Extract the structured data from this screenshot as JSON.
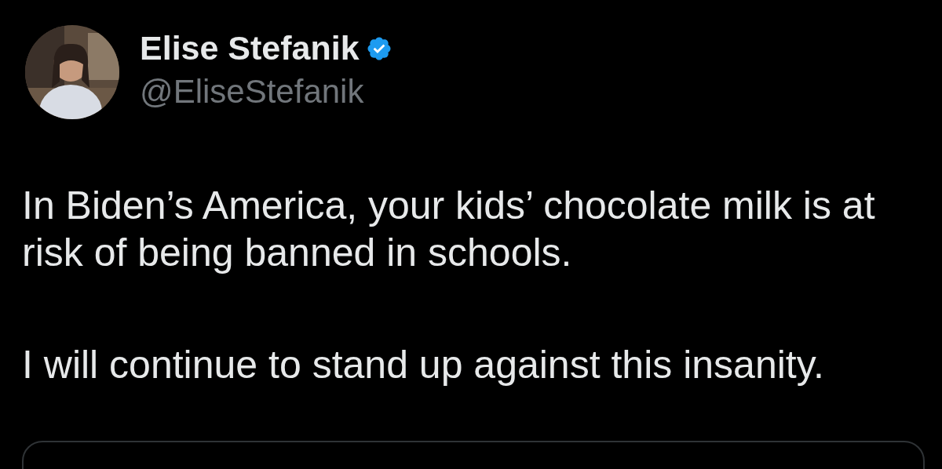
{
  "author": {
    "name": "Elise Stefanik",
    "handle": "@EliseStefanik",
    "verified": true
  },
  "post": {
    "paragraphs": [
      "In Biden’s America, your kids’ chocolate milk is at risk of being banned in schools.",
      "I will continue to stand up against this insanity."
    ]
  },
  "attachment": {
    "kind": "card"
  }
}
